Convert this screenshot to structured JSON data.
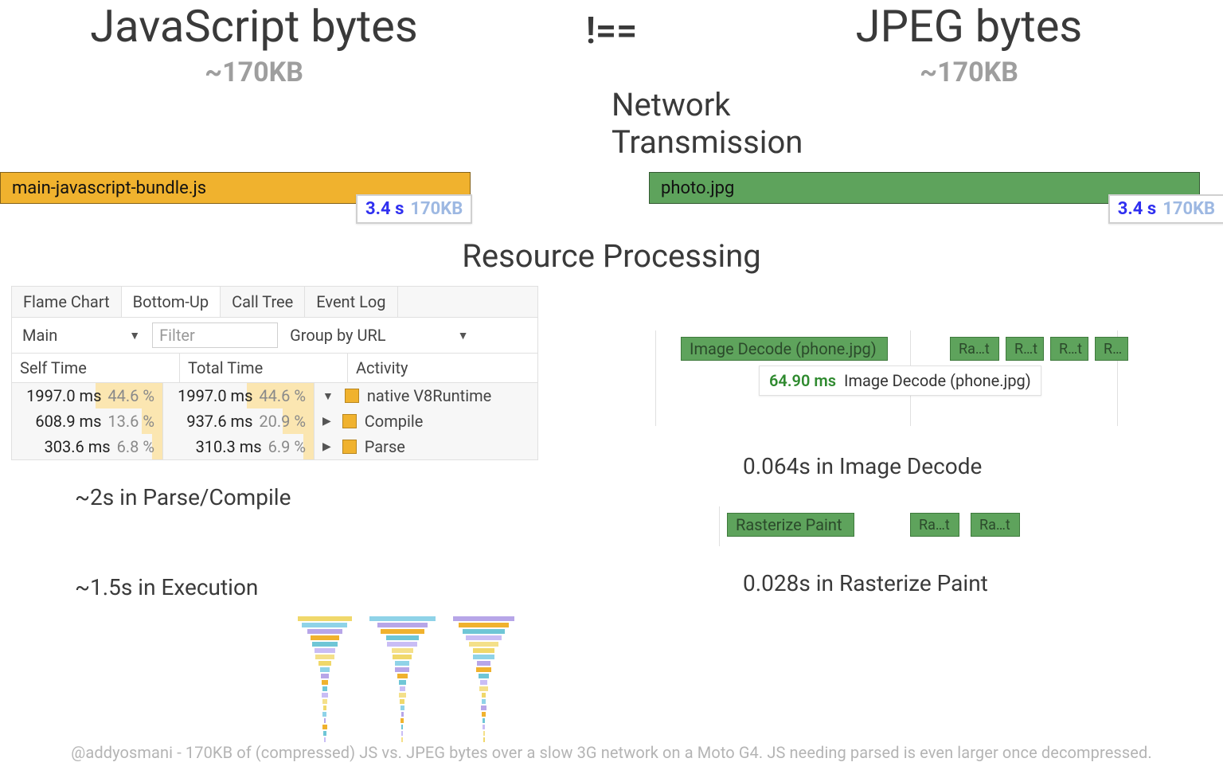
{
  "header": {
    "left_title": "JavaScript bytes",
    "right_title": "JPEG bytes",
    "neq": "!==",
    "left_size": "~170KB",
    "right_size": "~170KB"
  },
  "sections": {
    "network": "Network Transmission",
    "processing": "Resource Processing"
  },
  "bars": {
    "js_label": "main-javascript-bundle.js",
    "jpg_label": "photo.jpg",
    "tag_time": "3.4 s",
    "tag_size": "170KB"
  },
  "panel": {
    "tabs": [
      "Flame Chart",
      "Bottom-Up",
      "Call Tree",
      "Event Log"
    ],
    "active_tab_index": 1,
    "thread": "Main",
    "filter_placeholder": "Filter",
    "group": "Group by URL",
    "columns": [
      "Self Time",
      "Total Time",
      "Activity"
    ],
    "rows": [
      {
        "self": "1997.0 ms",
        "self_pct": "44.6 %",
        "self_fill": 44.6,
        "total": "1997.0 ms",
        "total_pct": "44.6 %",
        "total_fill": 44.6,
        "icon": "▼",
        "activity": "native V8Runtime"
      },
      {
        "self": "608.9 ms",
        "self_pct": "13.6 %",
        "self_fill": 13.6,
        "total": "937.6 ms",
        "total_pct": "20.9 %",
        "total_fill": 20.9,
        "icon": "▶",
        "activity": "Compile"
      },
      {
        "self": "303.6 ms",
        "self_pct": "6.8 %",
        "self_fill": 6.8,
        "total": "310.3 ms",
        "total_pct": "6.9 %",
        "total_fill": 6.9,
        "icon": "▶",
        "activity": "Parse"
      }
    ]
  },
  "left_stats": {
    "parse": "~2s in Parse/Compile",
    "exec": "~1.5s in Execution"
  },
  "decode": {
    "main": "Image Decode (phone.jpg)",
    "sides": [
      "Ra…t",
      "R…t",
      "R…t",
      "R…"
    ],
    "tip_ms": "64.90 ms",
    "tip_label": "Image Decode (phone.jpg)"
  },
  "raster": {
    "main": "Rasterize Paint",
    "sides": [
      "Ra…t",
      "Ra…t"
    ]
  },
  "right_stats": {
    "decode": "0.064s in Image Decode",
    "raster": "0.028s in Rasterize Paint"
  },
  "footer": "@addyosmani - 170KB of (compressed) JS vs. JPEG bytes over a slow 3G network on a Moto G4. JS needing parsed is even larger once decompressed."
}
